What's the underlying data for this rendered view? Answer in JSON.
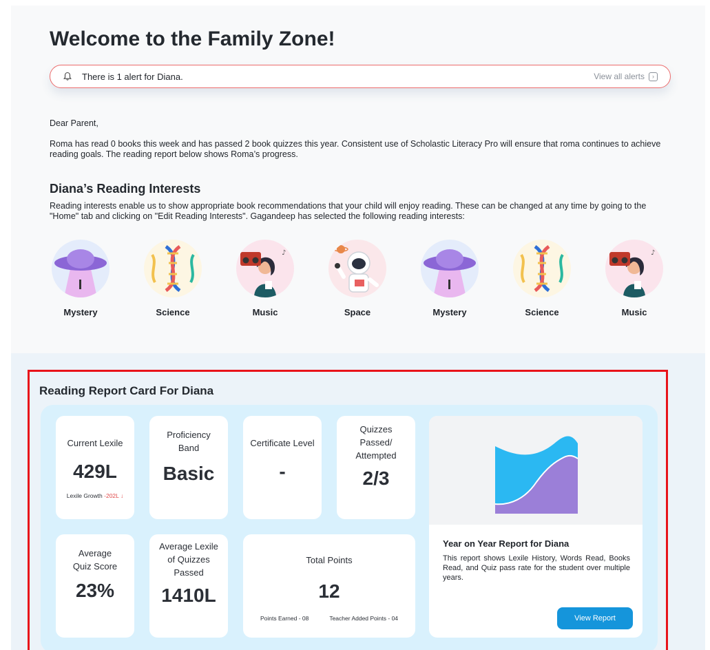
{
  "page": {
    "title": "Welcome to the Family Zone!",
    "alert": {
      "message": "There is 1 alert for Diana.",
      "view_all": "View all alerts",
      "view_all_icon": "chevron-right-icon"
    },
    "greeting": "Dear Parent,",
    "body": "Roma has read 0 books this week and has passed 2 book quizzes this year. Consistent use of Scholastic Literacy Pro will ensure that roma continues to achieve reading goals. The reading report below shows Roma’s progress."
  },
  "interests": {
    "heading": "Diana’s Reading Interests",
    "description": "Reading interests enable us to show appropriate book recommendations that your child will enjoy reading. These can be changed at any time by going to the \"Home\" tab and clicking on \"Edit Reading Interests\". Gagandeep has selected the following reading interests:",
    "items": [
      {
        "label": "Mystery",
        "icon": "ufo-icon"
      },
      {
        "label": "Science",
        "icon": "dna-icon"
      },
      {
        "label": "Music",
        "icon": "boombox-icon"
      },
      {
        "label": "Space",
        "icon": "astronaut-icon"
      },
      {
        "label": "Mystery",
        "icon": "ufo-icon"
      },
      {
        "label": "Science",
        "icon": "dna-icon"
      },
      {
        "label": "Music",
        "icon": "boombox-icon"
      }
    ]
  },
  "report": {
    "heading": "Reading Report Card For Diana",
    "current_lexile": {
      "label": "Current Lexile",
      "value": "429L",
      "growth_label": "Lexile Growth",
      "growth_value": "-202L"
    },
    "proficiency": {
      "label_1": "Proficiency",
      "label_2": "Band",
      "value": "Basic"
    },
    "certificate": {
      "label": "Certificate Level",
      "value": "-"
    },
    "quizzes": {
      "label_1": "Quizzes",
      "label_2": "Passed/",
      "label_3": "Attempted",
      "value": "2/3"
    },
    "avg_quiz": {
      "label_1": "Average",
      "label_2": "Quiz Score",
      "value": "23%"
    },
    "avg_lexile": {
      "label_1": "Average Lexile",
      "label_2": "of Quizzes",
      "label_3": "Passed",
      "value": "1410L"
    },
    "total_points": {
      "label": "Total Points",
      "value": "12",
      "earned": "Points Earned - 08",
      "teacher": "Teacher Added Points - 04"
    },
    "yoy": {
      "title": "Year on Year Report for Diana",
      "description": "This report shows Lexile History, Words Read, Books Read, and Quiz pass rate for the student over multiple years.",
      "button": "View Report"
    }
  },
  "colors": {
    "accent": "#1595db",
    "alert_border": "#ec6b6b",
    "highlight": "#e8131a",
    "panel": "#d9f1fd",
    "chart_blue": "#2bb8f2",
    "chart_purple": "#9b7fd8"
  }
}
